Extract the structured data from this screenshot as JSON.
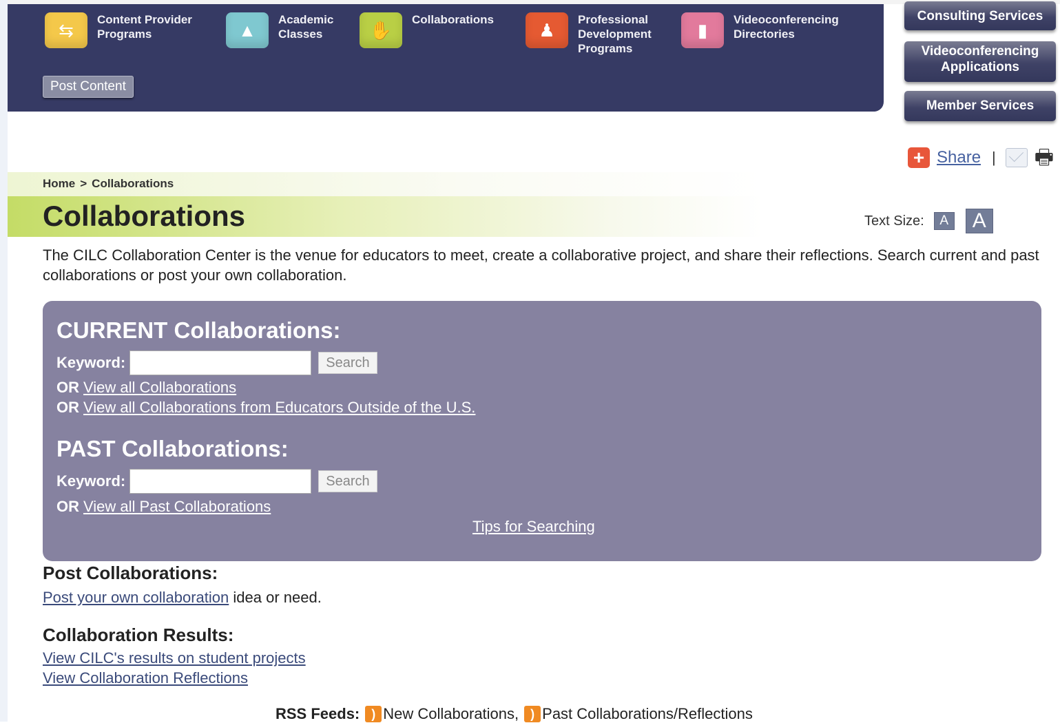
{
  "nav": {
    "items": [
      {
        "label": "Content Provider\nPrograms",
        "icon": "handshake-circle-icon",
        "color": "#f4c84a"
      },
      {
        "label": "Academic\nClasses",
        "icon": "graduation-cap-icon",
        "color": "#7fc8d0"
      },
      {
        "label": "Collaborations",
        "icon": "handshake-icon",
        "color": "#b9cf45"
      },
      {
        "label": "Professional\nDevelopment\nPrograms",
        "icon": "presenter-icon",
        "color": "#e55a32"
      },
      {
        "label": "Videoconferencing\nDirectories",
        "icon": "book-icon",
        "color": "#e27a9c"
      }
    ],
    "post_content": "Post Content"
  },
  "side_buttons": {
    "consulting": "Consulting Services",
    "vc_apps": "Videoconferencing\nApplications",
    "member": "Member Services"
  },
  "share": {
    "label": "Share",
    "separator": "|"
  },
  "breadcrumb": {
    "home": "Home",
    "sep": ">",
    "current": "Collaborations"
  },
  "page_title": "Collaborations",
  "text_size": {
    "label": "Text Size:",
    "small": "A",
    "large": "A"
  },
  "intro": "The CILC Collaboration Center is the venue for educators to meet, create a collaborative project, and share their reflections. Search current and past collaborations or post your own collaboration.",
  "current": {
    "heading": "CURRENT Collaborations:",
    "keyword_label": "Keyword:",
    "search_label": "Search",
    "or": "OR",
    "view_all": "View all Collaborations",
    "view_outside": "View all Collaborations from Educators Outside of the U.S."
  },
  "past": {
    "heading": "PAST Collaborations:",
    "keyword_label": "Keyword:",
    "search_label": "Search",
    "or": "OR",
    "view_all": "View all Past Collaborations"
  },
  "tips": "Tips for Searching",
  "post_section": {
    "heading": "Post Collaborations:",
    "link": "Post your own collaboration",
    "suffix": "idea or need."
  },
  "results_section": {
    "heading": "Collaboration Results:",
    "link1": "View CILC's results on student projects",
    "link2": "View Collaboration Reflections"
  },
  "rss": {
    "label": "RSS Feeds:",
    "new": "New Collaborations,",
    "past": "Past Collaborations/Reflections"
  }
}
